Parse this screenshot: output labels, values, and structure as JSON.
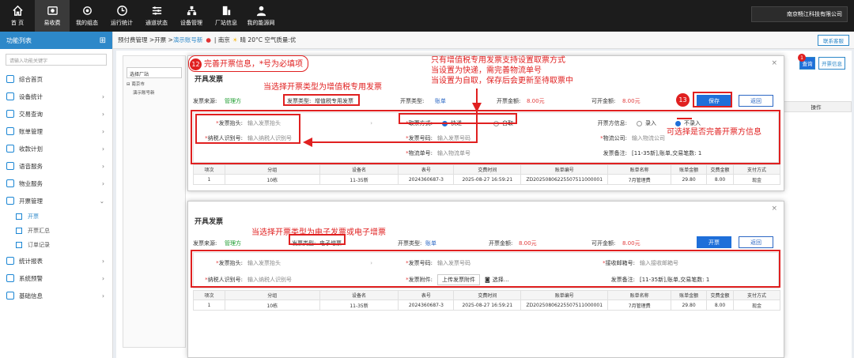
{
  "nav": {
    "items": [
      {
        "label": "首 页",
        "icon": "home-icon"
      },
      {
        "label": "易收费",
        "icon": "payment-icon",
        "active": true
      },
      {
        "label": "我的组态",
        "icon": "config-icon"
      },
      {
        "label": "运行统计",
        "icon": "stats-icon"
      },
      {
        "label": "通道状态",
        "icon": "channel-icon"
      },
      {
        "label": "设备管理",
        "icon": "device-icon"
      },
      {
        "label": "厂站信息",
        "icon": "station-icon"
      },
      {
        "label": "我的能源网",
        "icon": "user-icon"
      }
    ],
    "company": "南京畅江科技有限公司"
  },
  "sidebar": {
    "title": "功能列表",
    "search_placeholder": "请输入功能关键字",
    "items": [
      {
        "label": "综合首页",
        "arrow": ""
      },
      {
        "label": "设备统计",
        "arrow": "›"
      },
      {
        "label": "交易查询",
        "arrow": "›"
      },
      {
        "label": "账单管理",
        "arrow": "›"
      },
      {
        "label": "收款计划",
        "arrow": "›"
      },
      {
        "label": "语音服务",
        "arrow": "›"
      },
      {
        "label": "物业服务",
        "arrow": "›"
      },
      {
        "label": "开票管理",
        "arrow": "⌄"
      }
    ],
    "subitems": [
      {
        "label": "开票",
        "active": true
      },
      {
        "label": "开票汇总"
      },
      {
        "label": "订单记录"
      }
    ],
    "items_after": [
      {
        "label": "统计报表",
        "arrow": "›"
      },
      {
        "label": "系统预警",
        "arrow": "›"
      },
      {
        "label": "基础信息",
        "arrow": "›"
      }
    ]
  },
  "breadcrumb": {
    "path": "预付费管理 >开票 > ",
    "current": "演示账号新",
    "location": "南京",
    "weather": "晴 20°C 空气质量:优",
    "help": "联系客服"
  },
  "background": {
    "select_label": "选择厂站",
    "tree_root": "⊟ 南京市",
    "tree_child": "演示账号新",
    "btn_right": "开票信息",
    "btn_query": "查询",
    "btn_badge": "1",
    "th_op": "操作"
  },
  "dialog1": {
    "title": "开具发票",
    "close": "×",
    "source_label": "发票来源:",
    "source_value": "管理方",
    "type_label": "发票类型:",
    "type_value": "增值税专用发票",
    "open_type_label": "开票类型:",
    "open_type_value": "账单",
    "amount_label": "开票金额:",
    "amount_value": "8.00元",
    "avail_label": "可开金额:",
    "avail_value": "8.00元",
    "save": "保存",
    "back": "返回",
    "fields": {
      "header_label": "发票抬头:",
      "header_ph": "输入发票抬头",
      "taxid_label": "纳税人识别号:",
      "taxid_ph": "输入纳税人识别号",
      "pick_label": "取票方式:",
      "pick_opt1": "快递",
      "pick_opt2": "自取",
      "no_label": "发票号码:",
      "no_ph": "输入发票号码",
      "track_label": "物流单号:",
      "track_ph": "输入物流单号",
      "opener_label": "开票方信息:",
      "opener_opt1": "录入",
      "opener_opt2": "不录入",
      "logi_label": "物流公司:",
      "logi_ph": "输入物流公司",
      "remark_label": "发票备注:",
      "remark_value": "[11-35新],账单,交易笔数: 1"
    }
  },
  "dialog2": {
    "title": "开具发票",
    "close": "×",
    "source_label": "发票来源:",
    "source_value": "管理方",
    "type_label": "发票类型:",
    "type_value": "电子增票",
    "open_type_label": "开票类型:",
    "open_type_value": "账单",
    "amount_label": "开票金额:",
    "amount_value": "8.00元",
    "avail_label": "可开金额:",
    "avail_value": "8.00元",
    "submit": "开票",
    "back": "返回",
    "fields": {
      "header_label": "发票抬头:",
      "header_ph": "输入发票抬头",
      "taxid_label": "纳税人识别号:",
      "taxid_ph": "输入纳税人识别号",
      "no_label": "发票号码:",
      "no_ph": "输入发票号码",
      "attach_label": "发票附件:",
      "upload_btn": "上传发票附件",
      "choose": "选择…",
      "mail_label": "接收邮箱号:",
      "mail_ph": "输入接收邮箱号",
      "remark_label": "发票备注:",
      "remark_value": "[11-35新],账单,交易笔数: 1"
    }
  },
  "table": {
    "headers": [
      "项次",
      "分组",
      "设备名",
      "表号",
      "交费时间",
      "账单编号",
      "账单名称",
      "账单金额",
      "交费金额",
      "支付方式"
    ],
    "row": [
      "1",
      "10栋",
      "11-35新",
      "2024360687-3",
      "2025-08-27 16:59:21",
      "ZD20250806225507511000001",
      "7月管理费",
      "29.80",
      "8.00",
      "现金"
    ]
  },
  "annotations": {
    "step12_num": "12",
    "step12_text": "完善开票信息，*号为必填项",
    "step13_num": "13",
    "note_type1": "当选择开票类型为增值税专用发票",
    "note_pick1": "只有增值税专用发票支持设置取票方式",
    "note_pick2": "当设置为快递，需完善物流单号",
    "note_pick3": "当设置为自取，保存后会更新至待取票中",
    "note_opener": "可选择是否完善开票方信息",
    "note_type2": "当选择开票类型为电子发票或电子增票"
  },
  "colors": {
    "accent": "#2d88c9",
    "annotation": "#e02020",
    "primary_button": "#1e6fd9"
  }
}
